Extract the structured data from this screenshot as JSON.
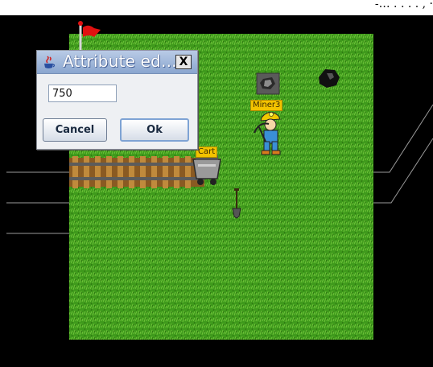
{
  "top_caption": "-… . . . . ,  ·",
  "dialog": {
    "title": "Attribute ed...",
    "close_label": "X",
    "input_value": "750",
    "cancel_label": "Cancel",
    "ok_label": "Ok"
  },
  "map": {
    "grass_color": "#3f9a1c",
    "background_color": "#000000",
    "flag_color": "#e01010"
  },
  "entities": {
    "miner_label": "Miner3",
    "cart_label": "Cart"
  },
  "icons": [
    "java-cup-icon",
    "flag-icon",
    "gold-nugget-icon",
    "coal-rock-icon",
    "miner-icon",
    "cart-icon",
    "shovel-icon",
    "rail-track-icon"
  ]
}
